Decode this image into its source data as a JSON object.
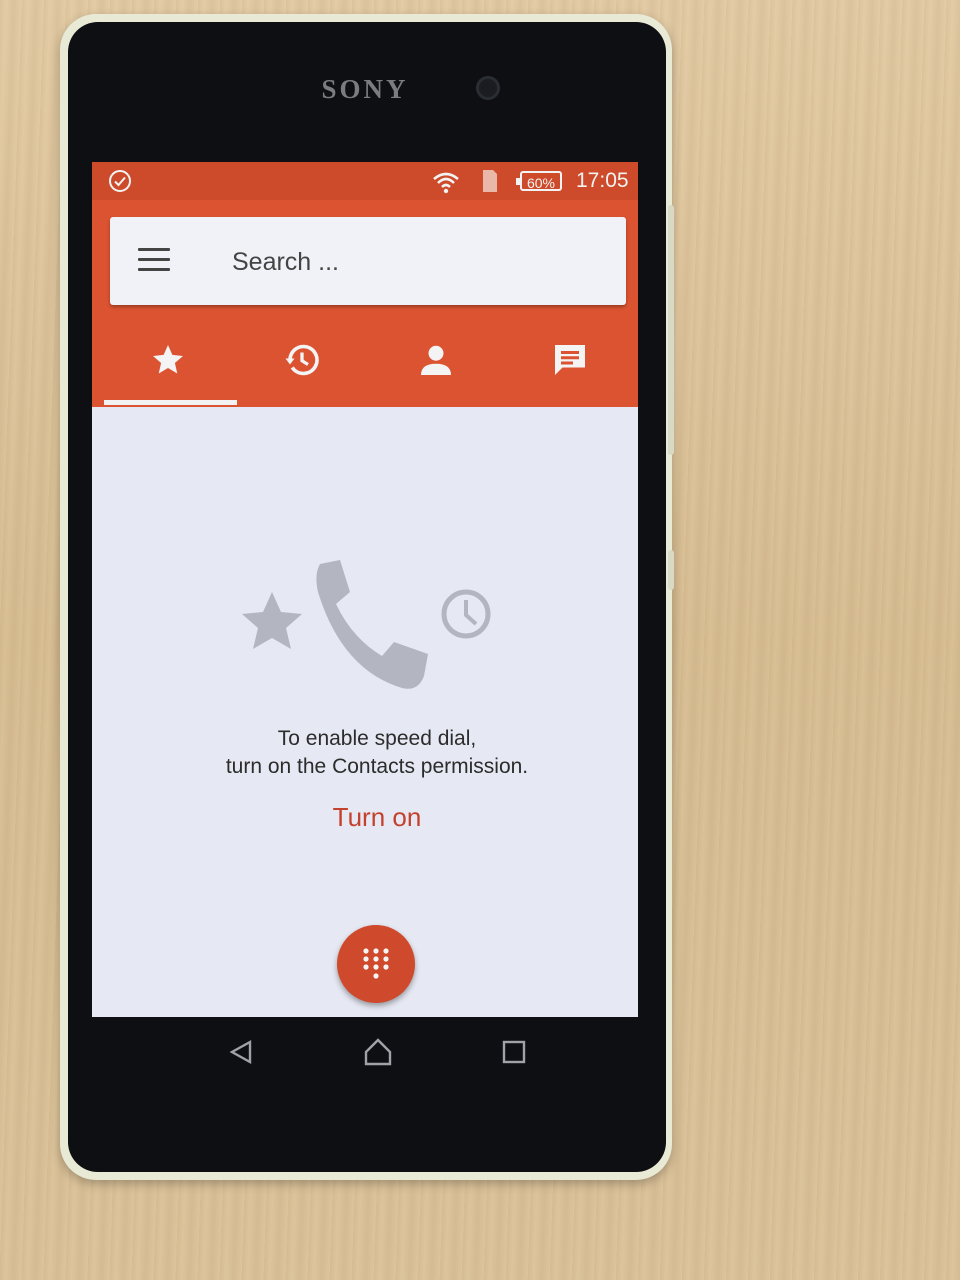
{
  "device": {
    "brand": "SONY"
  },
  "status_bar": {
    "time": "17:05",
    "battery": "60%"
  },
  "search": {
    "placeholder": "Search ..."
  },
  "tabs": [
    {
      "name": "favorites",
      "icon": "star-icon",
      "selected": true
    },
    {
      "name": "recents",
      "icon": "history-icon",
      "selected": false
    },
    {
      "name": "contacts",
      "icon": "person-icon",
      "selected": false
    },
    {
      "name": "messages",
      "icon": "message-icon",
      "selected": false
    }
  ],
  "empty_state": {
    "line1": "To enable speed dial,",
    "line2": "turn on the Contacts permission.",
    "action_label": "Turn on"
  },
  "colors": {
    "accent": "#db5331",
    "status_bar": "#cd4b2a",
    "action_text": "#c4412d"
  }
}
